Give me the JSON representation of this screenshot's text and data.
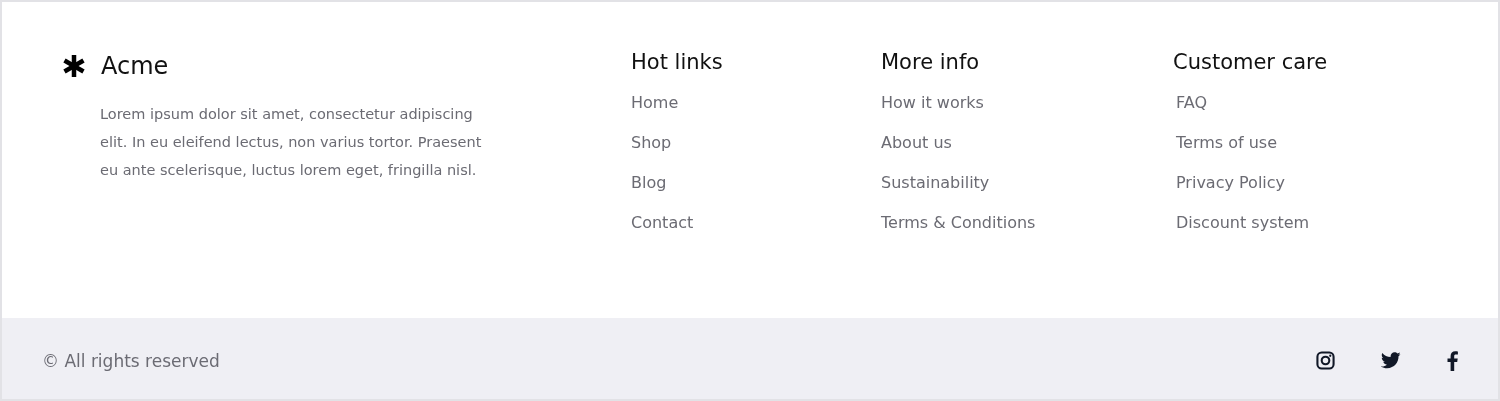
{
  "brand": {
    "name": "Acme",
    "description": "Lorem ipsum dolor sit amet, consectetur adipiscing elit. In eu eleifend lectus, non varius tortor. Praesent eu ante scelerisque, luctus lorem eget, fringilla nisl."
  },
  "columns": [
    {
      "title": "Hot links",
      "links": [
        "Home",
        "Shop",
        "Blog",
        "Contact"
      ]
    },
    {
      "title": "More info",
      "links": [
        "How it works",
        "About us",
        "Sustainability",
        "Terms & Conditions"
      ]
    },
    {
      "title": "Customer care",
      "links": [
        "FAQ",
        "Terms of use",
        "Privacy Policy",
        "Discount system"
      ]
    }
  ],
  "bottom_bar": {
    "copyright": "© All rights reserved",
    "social": [
      {
        "kind": "instagram"
      },
      {
        "kind": "twitter"
      },
      {
        "kind": "facebook"
      }
    ]
  }
}
